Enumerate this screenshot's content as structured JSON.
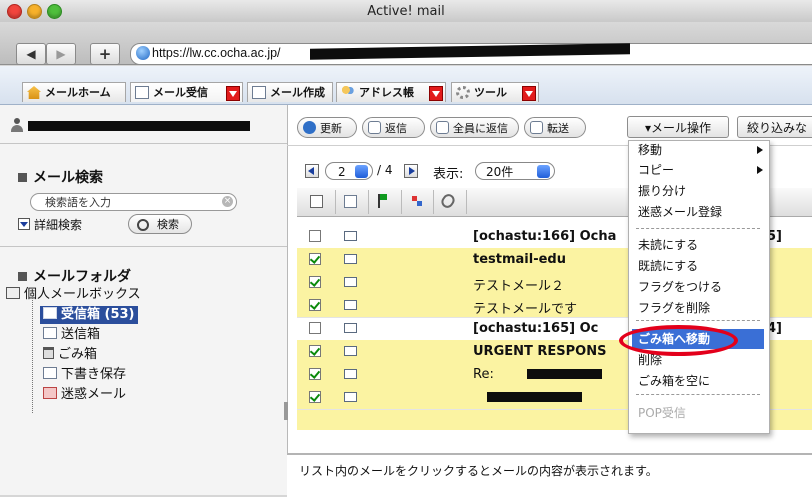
{
  "window": {
    "title": "Active! mail",
    "url": "https://lw.cc.ocha.ac.jp/"
  },
  "nav": {
    "back": "◀",
    "forward": "▶",
    "add": "+"
  },
  "tabs": [
    {
      "label": "メールホーム"
    },
    {
      "label": "メール受信"
    },
    {
      "label": "メール作成"
    },
    {
      "label": "アドレス帳"
    },
    {
      "label": "ツール"
    }
  ],
  "search": {
    "heading": "メール検索",
    "placeholder": "検索語を入力",
    "advanced": "詳細検索",
    "button": "検索"
  },
  "folders": {
    "heading": "メールフォルダ",
    "root": "個人メールボックス",
    "items": [
      {
        "label": "受信箱 (53)"
      },
      {
        "label": "送信箱"
      },
      {
        "label": "ごみ箱"
      },
      {
        "label": "下書き保存"
      },
      {
        "label": "迷惑メール"
      }
    ]
  },
  "toolbar": {
    "refresh": "更新",
    "reply": "返信",
    "reply_all": "全員に返信",
    "forward": "転送",
    "mail_ops": "▾メール操作",
    "filter": "絞り込みな"
  },
  "pager": {
    "page": "2",
    "total": "/ 4",
    "display_label": "表示:",
    "per_page": "20件"
  },
  "messages": [
    {
      "subject": "[ochastu:166] Ocha",
      "tail": "5]",
      "highlight": false,
      "checked": false,
      "bold": true
    },
    {
      "subject": "testmail-edu",
      "tail": "",
      "highlight": true,
      "checked": true,
      "bold": true
    },
    {
      "subject": "テストメール２",
      "tail": "",
      "highlight": true,
      "checked": true,
      "bold": false
    },
    {
      "subject": "テストメールです",
      "tail": "",
      "highlight": true,
      "checked": true,
      "bold": false
    },
    {
      "subject": "[ochastu:165] Oc",
      "tail": "4]",
      "highlight": false,
      "checked": false,
      "bold": true
    },
    {
      "subject": "URGENT RESPONS",
      "tail": "",
      "highlight": true,
      "checked": true,
      "bold": true
    },
    {
      "subject": "Re:",
      "tail": "",
      "highlight": true,
      "checked": true,
      "bold": false
    },
    {
      "subject": "",
      "tail": "",
      "highlight": true,
      "checked": true,
      "bold": false
    }
  ],
  "menu": {
    "items": [
      "移動",
      "コピー",
      "振り分け",
      "迷惑メール登録",
      "未読にする",
      "既読にする",
      "フラグをつける",
      "フラグを削除",
      "ごみ箱へ移動",
      "削除",
      "ごみ箱を空に",
      "POP受信"
    ]
  },
  "preview": {
    "text": "リスト内のメールをクリックするとメールの内容が表示されます。"
  },
  "colors": {
    "selected_folder": "#2b4e9c",
    "highlight_row": "#fbf3a2",
    "menu_selected": "#3a6fd6",
    "annotation": "#e3001b"
  }
}
